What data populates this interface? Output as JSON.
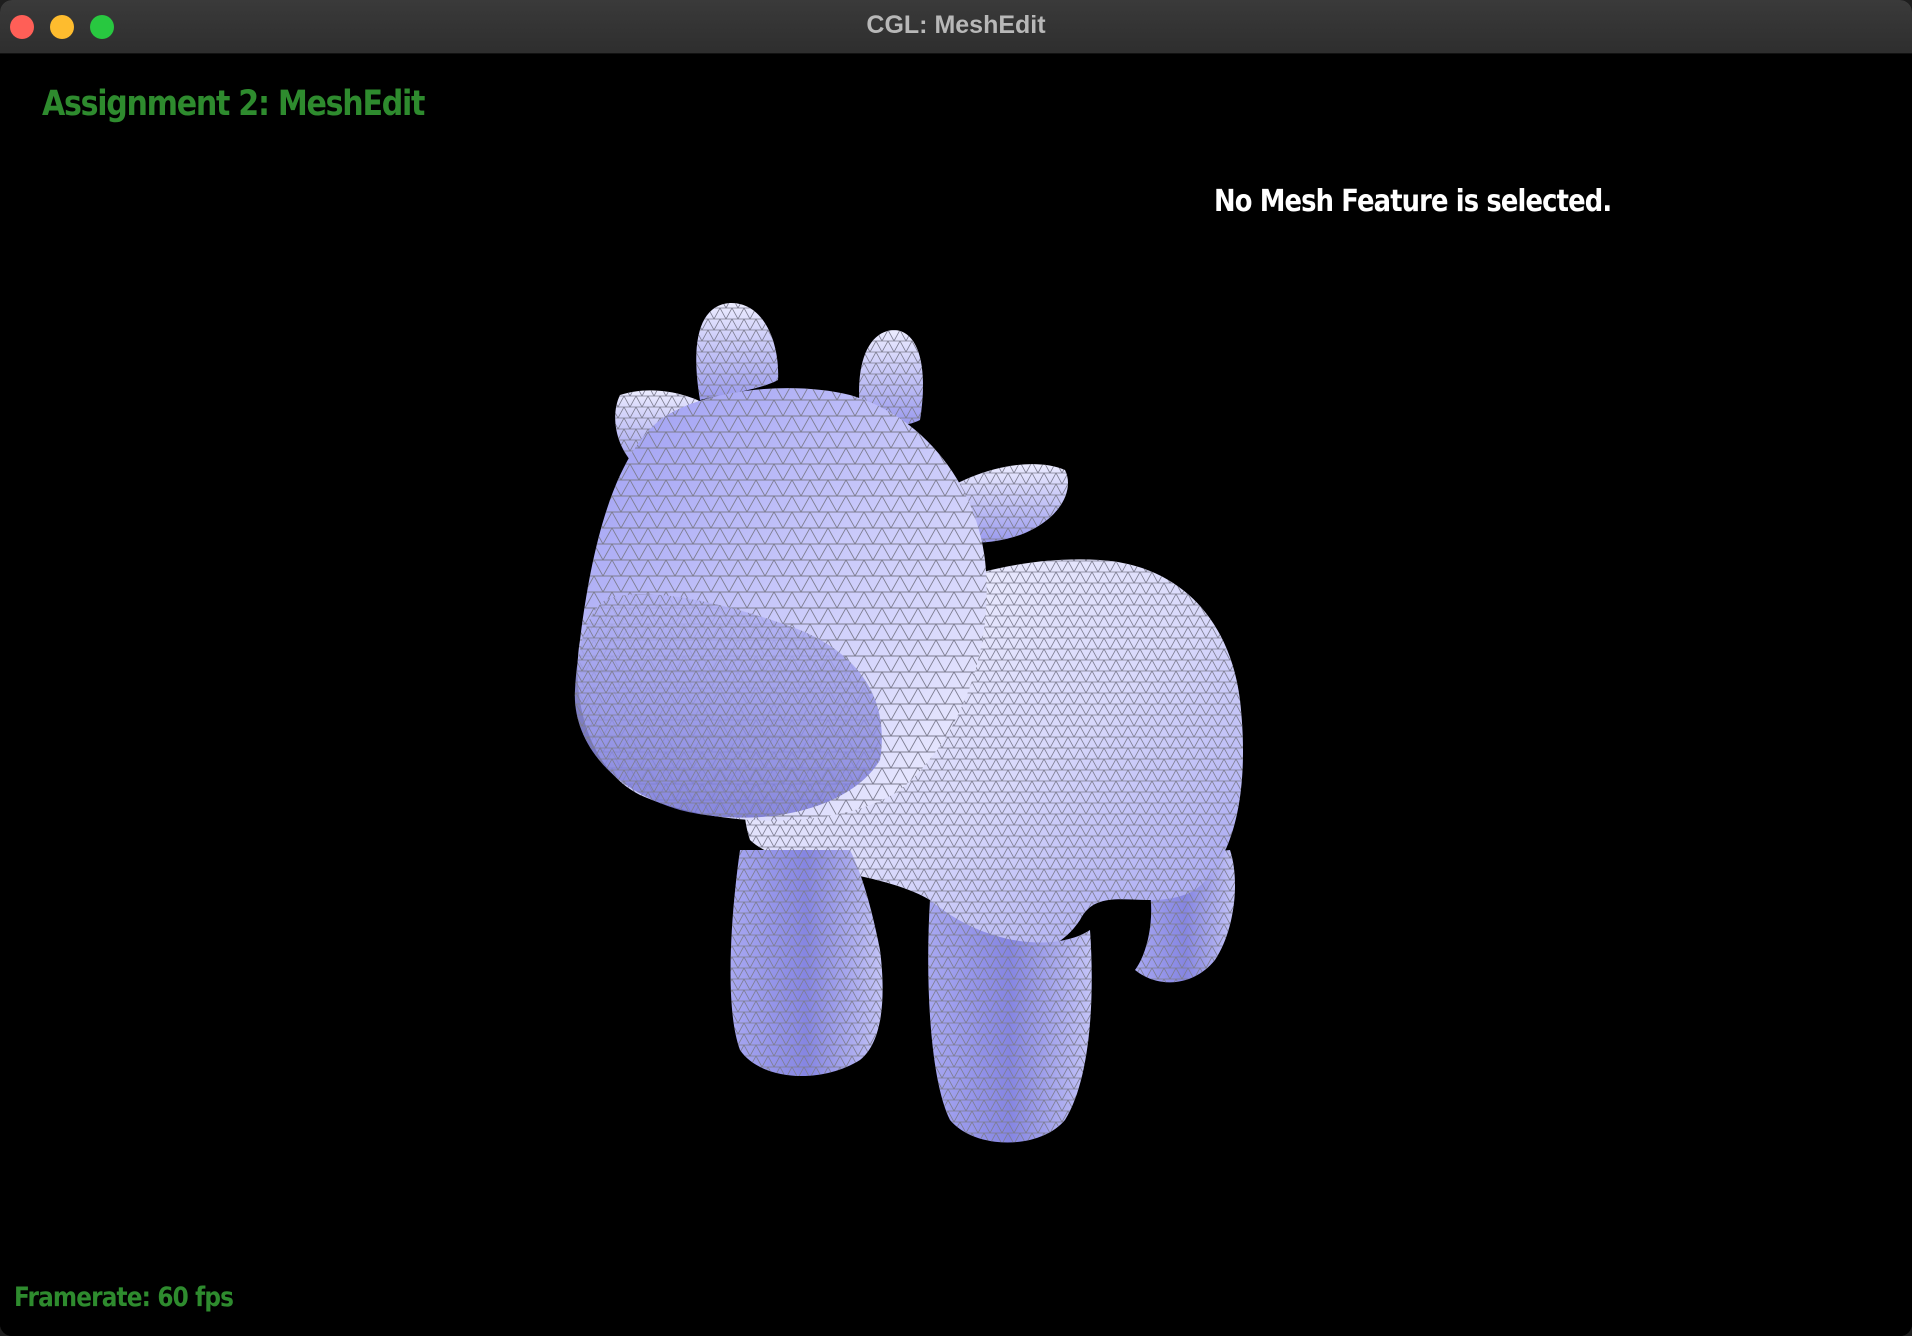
{
  "window": {
    "title": "CGL: MeshEdit",
    "buttons": {
      "close": "#ff5f57",
      "minimize": "#febc2e",
      "maximize": "#28c840"
    }
  },
  "hud": {
    "title": "Assignment 2: MeshEdit",
    "status": "No Mesh Feature is selected.",
    "framerate": "Framerate: 60 fps",
    "colors": {
      "title": "#2e8b2e",
      "status": "#ffffff",
      "framerate": "#2e8b2e"
    }
  },
  "mesh": {
    "name": "cow",
    "colors": {
      "fill_light": "#f4f4ff",
      "fill_mid": "#c4c4f8",
      "fill_dark": "#8c8ce8",
      "wire": "#808090"
    }
  }
}
